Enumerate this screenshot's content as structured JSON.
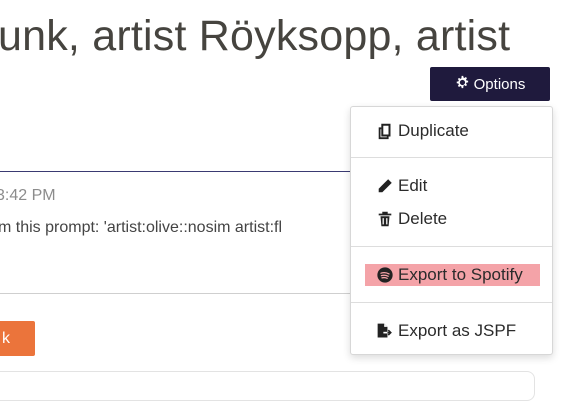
{
  "page": {
    "title": "unk, artist Röyksopp, artist",
    "timestamp": "3:42 PM",
    "prompt_text": "m this prompt: 'artist:olive::nosim artist:fl",
    "orange_button_label": "k"
  },
  "options_button": {
    "label": "Options",
    "icon": "gear-icon"
  },
  "menu": {
    "items": [
      {
        "label": "Duplicate",
        "icon": "copy-icon"
      },
      {
        "label": "Edit",
        "icon": "pencil-icon"
      },
      {
        "label": "Delete",
        "icon": "trash-icon"
      },
      {
        "label": "Export to Spotify",
        "icon": "spotify-icon",
        "highlight_color": "#f4a3a8"
      },
      {
        "label": "Export as JSPF",
        "icon": "file-export-icon"
      }
    ]
  },
  "colors": {
    "options_bg": "#1f1a3d",
    "orange_button": "#eb743b",
    "highlight": "#f4a3a8"
  }
}
